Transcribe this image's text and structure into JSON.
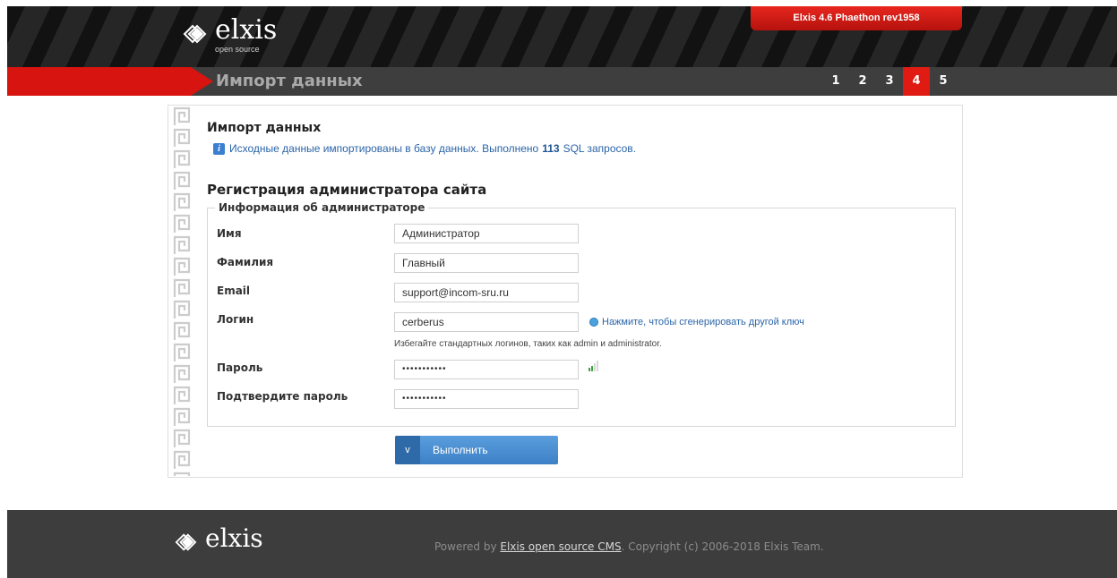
{
  "header": {
    "logo_text": "elxis",
    "logo_subtitle": "open source",
    "version": "Elxis 4.6 Phaethon rev1958"
  },
  "titlebar": {
    "title": "Импорт данных",
    "steps": [
      {
        "label": "1",
        "active": false
      },
      {
        "label": "2",
        "active": false
      },
      {
        "label": "3",
        "active": false
      },
      {
        "label": "4",
        "active": true
      },
      {
        "label": "5",
        "active": false
      }
    ]
  },
  "import": {
    "heading": "Импорт данных",
    "info_prefix": "Исходные данные импортированы в базу данных. Выполнено",
    "info_count": "113",
    "info_suffix": "SQL запросов."
  },
  "admin": {
    "heading": "Регистрация администратора сайта",
    "legend": "Информация об администраторе",
    "fields": {
      "first_name": {
        "label": "Имя",
        "value": "Администратор"
      },
      "last_name": {
        "label": "Фамилия",
        "value": "Главный"
      },
      "email": {
        "label": "Email",
        "value": "support@incom-sru.ru"
      },
      "login": {
        "label": "Логин",
        "value": "cerberus"
      },
      "password": {
        "label": "Пароль",
        "value": "•••••••••••"
      },
      "confirm": {
        "label": "Подтвердите пароль",
        "value": "•••••••••••"
      }
    },
    "generate_link": "Нажмите, чтобы сгенерировать другой ключ",
    "login_hint": "Избегайте стандартных логинов, таких как admin и administrator.",
    "submit_icon": "v",
    "submit_label": "Выполнить"
  },
  "footer": {
    "logo_text": "elxis",
    "powered_prefix": "Powered by",
    "powered_link": "Elxis open source CMS",
    "copyright": ". Copyright (c) 2006-2018 Elxis Team."
  },
  "colors": {
    "accent_red": "#e01b14",
    "link_blue": "#2a64a8",
    "button_blue": "#4a8fd4",
    "header_dark": "#1b1b1b",
    "footer_dark": "#3d3d3d"
  },
  "icons": [
    "elxis-logo-icon",
    "info-icon",
    "refresh-key-icon",
    "password-strength-icon",
    "checkmark-icon"
  ]
}
